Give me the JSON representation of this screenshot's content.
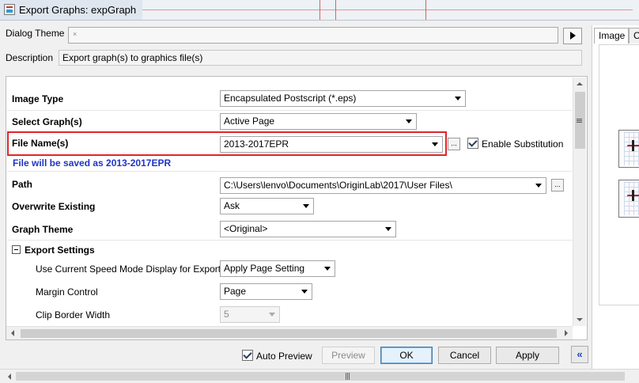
{
  "window": {
    "title": "Export Graphs: expGraph"
  },
  "dialog_theme": {
    "label": "Dialog Theme",
    "value": "",
    "clear_glyph": "×"
  },
  "description": {
    "label": "Description",
    "value": "Export graph(s) to graphics file(s)"
  },
  "fields": {
    "image_type": {
      "label": "Image Type",
      "value": "Encapsulated Postscript (*.eps)"
    },
    "select_graphs": {
      "label": "Select Graph(s)",
      "value": "Active Page"
    },
    "file_name": {
      "label": "File Name(s)",
      "value": "2013-2017EPR",
      "enable_substitution_label": "Enable Substitution",
      "enable_substitution_checked": true
    },
    "save_note": "File will be saved as 2013-2017EPR",
    "path": {
      "label": "Path",
      "value": "C:\\Users\\lenvo\\Documents\\OriginLab\\2017\\User Files\\"
    },
    "overwrite_existing": {
      "label": "Overwrite Existing",
      "value": "Ask"
    },
    "graph_theme": {
      "label": "Graph Theme",
      "value": "<Original>"
    }
  },
  "export_settings": {
    "label": "Export Settings",
    "speed_mode": {
      "label": "Use Current Speed Mode Display for Export",
      "value": "Apply Page Setting"
    },
    "margin_control": {
      "label": "Margin Control",
      "value": "Page"
    },
    "clip_border_width": {
      "label": "Clip Border Width",
      "value": "5"
    }
  },
  "buttons": {
    "ellipsis": "...",
    "auto_preview_label": "Auto Preview",
    "auto_preview_checked": true,
    "preview": "Preview",
    "ok": "OK",
    "cancel": "Cancel",
    "apply": "Apply",
    "collapse": "«"
  },
  "right_panel": {
    "tabs": [
      "Image",
      "C"
    ]
  },
  "icons": {
    "app": "origin-app-icon",
    "play": "play-right-icon",
    "collapse": "minus-box-icon"
  },
  "colors": {
    "highlight": "#e0262b",
    "note": "#1f35c4"
  }
}
